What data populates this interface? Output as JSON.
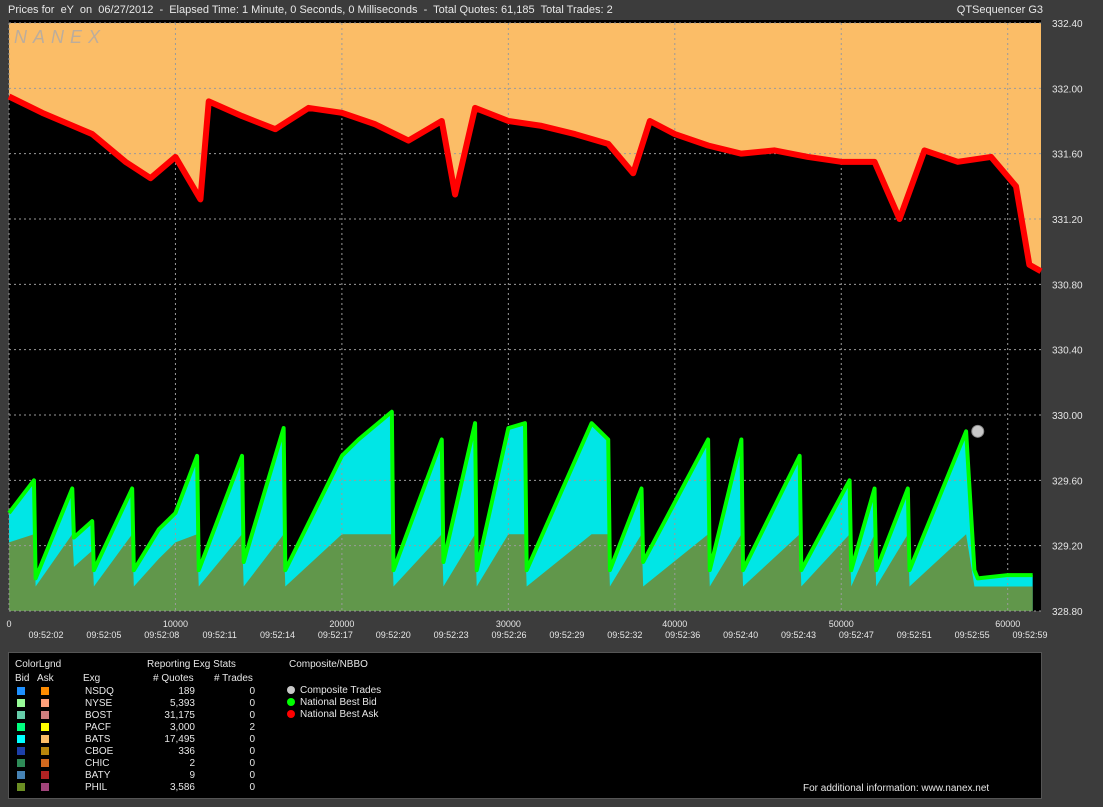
{
  "header": {
    "title": "Prices for  eY  on  06/27/2012  -  Elapsed Time: 1 Minute, 0 Seconds, 0 Milliseconds  -  Total Quotes: 61,185  Total Trades: 2",
    "app_name": "QTSequencer G3",
    "watermark": "NANEX"
  },
  "colors": {
    "ask_fill": "#fbbd67",
    "ask_nbbo": "#ff0000",
    "bid_nbbo": "#00ff00",
    "bid_fill": "#00ffff",
    "lower_fill": "#6b8e3a",
    "trade": "#c8c8c8",
    "grid": "#9a9a9a"
  },
  "chart_data": {
    "type": "line",
    "title": "Prices for  eY  on  06/27/2012",
    "y_ticks": [
      "332.40",
      "332.00",
      "331.60",
      "331.20",
      "330.80",
      "330.40",
      "330.00",
      "329.60",
      "329.20",
      "328.80"
    ],
    "ylim": [
      328.8,
      332.4
    ],
    "x_index_ticks": [
      "0",
      "10000",
      "20000",
      "30000",
      "40000",
      "50000",
      "60000"
    ],
    "x_index_values": [
      0,
      10000,
      20000,
      30000,
      40000,
      50000,
      60000
    ],
    "xlim": [
      0,
      62000
    ],
    "x_time_ticks": [
      "09:52:02",
      "09:52:05",
      "09:52:08",
      "09:52:11",
      "09:52:14",
      "09:52:17",
      "09:52:20",
      "09:52:23",
      "09:52:26",
      "09:52:29",
      "09:52:32",
      "09:52:36",
      "09:52:40",
      "09:52:43",
      "09:52:47",
      "09:52:51",
      "09:52:55",
      "09:52:59"
    ],
    "grid": true,
    "series": [
      {
        "name": "National Best Ask",
        "color": "#ff0000",
        "x": [
          0,
          2000,
          5000,
          7000,
          8500,
          10000,
          11500,
          12000,
          14000,
          16000,
          18000,
          20000,
          22000,
          24000,
          26000,
          26800,
          28000,
          30000,
          32000,
          34000,
          36000,
          37500,
          38500,
          40000,
          42000,
          44000,
          46000,
          48000,
          50000,
          52000,
          53500,
          55000,
          57000,
          59000,
          60500,
          61300,
          62000
        ],
        "values": [
          331.95,
          331.85,
          331.72,
          331.55,
          331.45,
          331.58,
          331.32,
          331.92,
          331.83,
          331.75,
          331.88,
          331.85,
          331.78,
          331.68,
          331.8,
          331.35,
          331.88,
          331.8,
          331.77,
          331.72,
          331.66,
          331.48,
          331.8,
          331.72,
          331.65,
          331.6,
          331.62,
          331.58,
          331.55,
          331.55,
          331.2,
          331.62,
          331.55,
          331.58,
          331.4,
          330.92,
          330.88
        ]
      },
      {
        "name": "National Best Bid",
        "color": "#00ff00",
        "x": [
          0,
          1500,
          1600,
          3800,
          3900,
          5000,
          5100,
          7400,
          7500,
          9000,
          10000,
          11300,
          11400,
          14000,
          14100,
          16500,
          16600,
          20000,
          21000,
          23000,
          23100,
          26000,
          26100,
          28000,
          28100,
          30000,
          31000,
          31100,
          35000,
          36000,
          36100,
          38000,
          38100,
          42000,
          42100,
          44000,
          44100,
          47500,
          47600,
          50500,
          50600,
          52000,
          52100,
          54000,
          54100,
          57500,
          58000,
          58200,
          60000,
          61500
        ],
        "values": [
          329.4,
          329.6,
          329.0,
          329.55,
          329.25,
          329.35,
          329.05,
          329.55,
          329.05,
          329.3,
          329.4,
          329.75,
          329.05,
          329.75,
          329.1,
          329.92,
          329.05,
          329.75,
          329.85,
          330.02,
          329.05,
          329.85,
          329.1,
          329.95,
          329.05,
          329.92,
          329.95,
          329.05,
          329.95,
          329.85,
          329.05,
          329.55,
          329.1,
          329.85,
          329.05,
          329.85,
          329.05,
          329.75,
          329.05,
          329.6,
          329.05,
          329.55,
          329.05,
          329.55,
          329.05,
          329.9,
          329.05,
          329.0,
          329.02,
          329.02
        ]
      },
      {
        "name": "Composite Trades",
        "color": "#c8c8c8",
        "x": [
          58200
        ],
        "values": [
          329.9
        ]
      }
    ]
  },
  "legend": {
    "color_legend_title": "ColorLgnd",
    "bid_header": "Bid",
    "ask_header": "Ask",
    "exg_header": "Exg",
    "stats_title": "Reporting Exg Stats",
    "quotes_header": "# Quotes",
    "trades_header": "# Trades",
    "composite_title": "Composite/NBBO",
    "rows": [
      {
        "exg": "NSDQ",
        "quotes": "189",
        "trades": "0",
        "bid_color": "#1e90ff",
        "ask_color": "#ff8c00"
      },
      {
        "exg": "NYSE",
        "quotes": "5,393",
        "trades": "0",
        "bid_color": "#98fb98",
        "ask_color": "#ffa07a"
      },
      {
        "exg": "BOST",
        "quotes": "31,175",
        "trades": "0",
        "bid_color": "#66cdaa",
        "ask_color": "#cd7f7f"
      },
      {
        "exg": "PACF",
        "quotes": "3,000",
        "trades": "2",
        "bid_color": "#00ff7f",
        "ask_color": "#ffff00"
      },
      {
        "exg": "BATS",
        "quotes": "17,495",
        "trades": "0",
        "bid_color": "#00ffff",
        "ask_color": "#fbbd67"
      },
      {
        "exg": "CBOE",
        "quotes": "336",
        "trades": "0",
        "bid_color": "#1c3fa8",
        "ask_color": "#b8860b"
      },
      {
        "exg": "CHIC",
        "quotes": "2",
        "trades": "0",
        "bid_color": "#2e8b57",
        "ask_color": "#d2691e"
      },
      {
        "exg": "BATY",
        "quotes": "9",
        "trades": "0",
        "bid_color": "#4682b4",
        "ask_color": "#b22222"
      },
      {
        "exg": "PHIL",
        "quotes": "3,586",
        "trades": "0",
        "bid_color": "#6b8e23",
        "ask_color": "#a0447a"
      }
    ],
    "composite_items": [
      {
        "label": "Composite Trades",
        "color": "#c8c8c8"
      },
      {
        "label": "National Best Bid",
        "color": "#00ff00"
      },
      {
        "label": "National Best Ask",
        "color": "#ff0000"
      }
    ],
    "footer": "For additional information: www.nanex.net"
  }
}
